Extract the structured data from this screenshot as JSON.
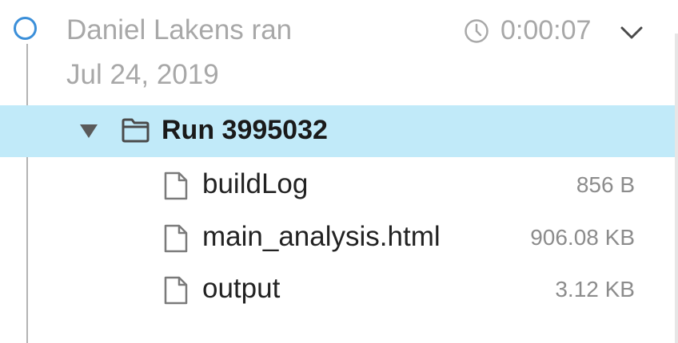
{
  "run": {
    "user_line": "Daniel Lakens ran",
    "date": "Jul 24, 2019",
    "duration": "0:00:07",
    "name": "Run 3995032"
  },
  "files": [
    {
      "name": "buildLog",
      "size": "856 B"
    },
    {
      "name": "main_analysis.html",
      "size": "906.08 KB"
    },
    {
      "name": "output",
      "size": "3.12 KB"
    }
  ],
  "icons": {
    "timeline": "timeline-dot-icon",
    "duration": "clock-icon",
    "toggle": "chevron-down-icon",
    "expand": "caret-down-icon",
    "folder": "folder-icon",
    "file": "file-icon"
  },
  "colors": {
    "timeline_dot": "#3b8fd9",
    "selected_row": "#c1eaf9",
    "muted_text": "#a8a8a8"
  }
}
